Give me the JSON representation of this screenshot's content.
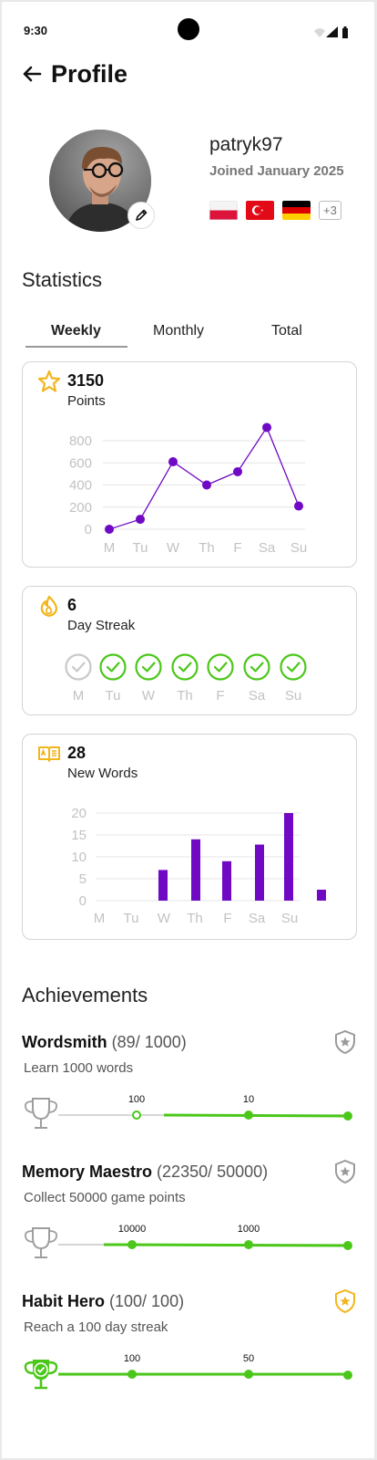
{
  "status_bar": {
    "time": "9:30"
  },
  "header": {
    "title": "Profile",
    "back_icon": "arrow-left-icon"
  },
  "profile": {
    "username": "patryk97",
    "joined": "Joined January 2025",
    "flags": [
      "poland",
      "turkey",
      "germany"
    ],
    "more_languages": "+3"
  },
  "statistics": {
    "heading": "Statistics",
    "tabs": [
      "Weekly",
      "Monthly",
      "Total"
    ],
    "active_tab": "Weekly"
  },
  "points_card": {
    "value": "3150",
    "label": "Points",
    "icon": "star-icon"
  },
  "streak_card": {
    "value": "6",
    "label": "Day Streak",
    "icon": "flame-icon",
    "days": [
      "M",
      "Tu",
      "W",
      "Th",
      "F",
      "Sa",
      "Su"
    ],
    "done": [
      false,
      true,
      true,
      true,
      true,
      true,
      true
    ]
  },
  "words_card": {
    "value": "28",
    "label": "New Words",
    "icon": "book-icon"
  },
  "chart_data": [
    {
      "type": "line",
      "categories": [
        "M",
        "Tu",
        "W",
        "Th",
        "F",
        "Sa",
        "Su"
      ],
      "values": [
        0,
        90,
        610,
        400,
        520,
        920,
        210
      ],
      "yticks": [
        "800",
        "600",
        "400",
        "200",
        "0"
      ],
      "ylim": [
        0,
        800
      ],
      "grid": true,
      "color": "#7009c4"
    },
    {
      "type": "bar",
      "categories": [
        "M",
        "Tu",
        "W",
        "Th",
        "F",
        "Sa",
        "Su"
      ],
      "values": [
        0,
        7,
        14,
        9,
        12.8,
        20,
        2.5
      ],
      "yticks": [
        "20",
        "15",
        "10",
        "5",
        "0"
      ],
      "ylim": [
        0,
        20
      ],
      "grid": true,
      "color": "#7009c4"
    }
  ],
  "achievements": {
    "heading": "Achievements",
    "items": [
      {
        "name": "Wordsmith",
        "progress": "(89/ 1000)",
        "description": "Learn 1000 words",
        "milestone_1": "100",
        "milestone_2": "10",
        "progress_fraction": 0.089,
        "unlocked": false
      },
      {
        "name": "Memory Maestro",
        "progress": "(22350/ 50000)",
        "description": "Collect 50000 game points",
        "milestone_1": "10000",
        "milestone_2": "1000",
        "progress_fraction": 0.447,
        "unlocked": false
      },
      {
        "name": "Habit Hero",
        "progress": "(100/ 100)",
        "description": "Reach a 100 day streak",
        "milestone_1": "100",
        "milestone_2": "50",
        "progress_fraction": 1.0,
        "unlocked": true
      }
    ]
  },
  "colors": {
    "accent_purple": "#7009c4",
    "success_green": "#4bc71a",
    "gold": "#f2b51c",
    "muted": "#c2c2c2"
  }
}
